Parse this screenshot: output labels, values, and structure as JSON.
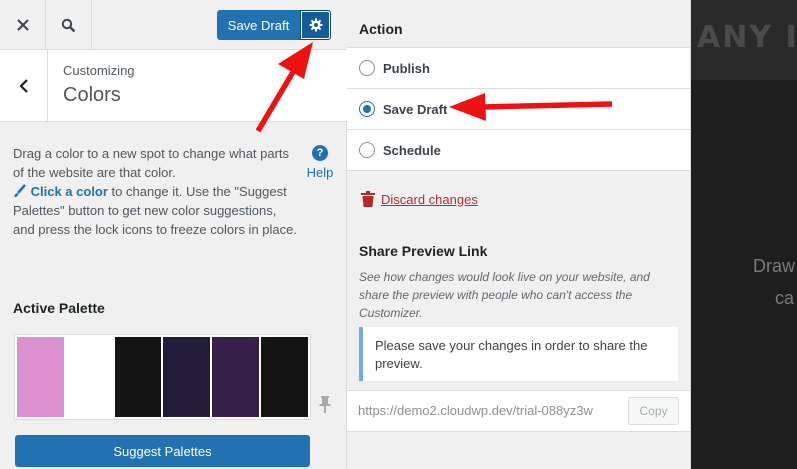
{
  "topbar": {
    "save_draft_label": "Save Draft"
  },
  "section": {
    "breadcrumb": "Customizing",
    "title": "Colors"
  },
  "description": {
    "part1": "Drag a color to a new spot to change what parts of the website are that color.",
    "link": "Click a color",
    "part2": " to change it. Use the \"Suggest Palettes\" button to get new color suggestions, and press the lock icons to freeze colors in place."
  },
  "help_label": "Help",
  "palette": {
    "title": "Active Palette",
    "colors": [
      "#dc90d0",
      "#ffffff",
      "#141414",
      "#231c38",
      "#36204a",
      "#141414"
    ]
  },
  "suggest_label": "Suggest Palettes",
  "publish": {
    "action_title": "Action",
    "options": [
      {
        "label": "Publish",
        "checked": false
      },
      {
        "label": "Save Draft",
        "checked": true
      },
      {
        "label": "Schedule",
        "checked": false
      }
    ],
    "discard_label": "Discard changes"
  },
  "share": {
    "title": "Share Preview Link",
    "description": "See how changes would look live on your website, and share the preview with people who can't access the Customizer.",
    "notice": "Please save your changes in order to share the preview.",
    "url": "https://demo2.cloudwp.dev/trial-088yz3w",
    "copy_label": "Copy"
  },
  "preview": {
    "brand": "ANY I",
    "line1": "Draw",
    "line2": "ca"
  },
  "colors": {
    "accent": "#2271b1",
    "annotation": "#ee1111",
    "danger": "#b32d2e"
  }
}
